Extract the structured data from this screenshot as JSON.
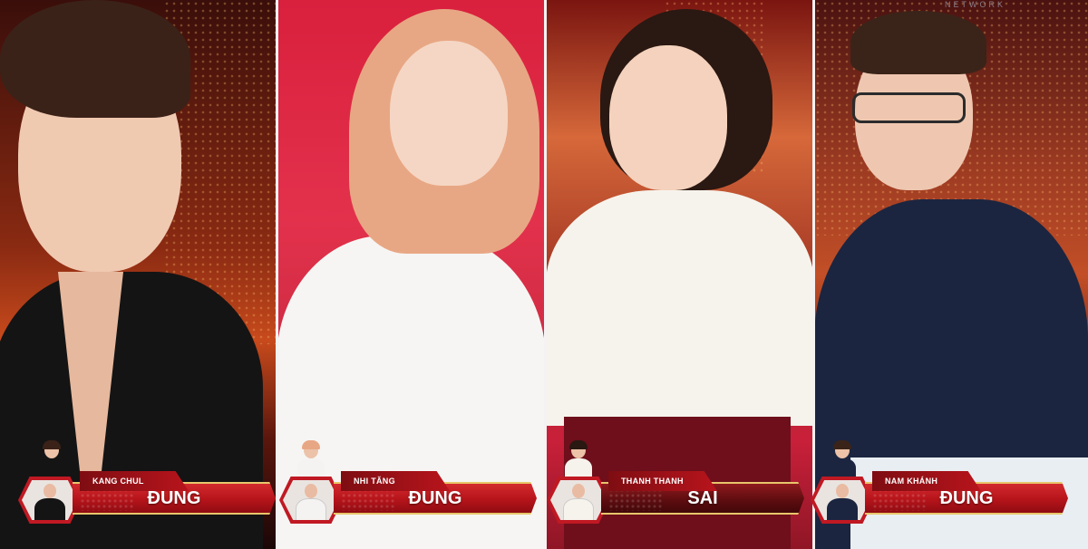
{
  "watermark": "NETWORK",
  "contestants": [
    {
      "name": "KANG CHUL",
      "result": "ĐÚNG",
      "correct": true,
      "shirt_color": "#111111"
    },
    {
      "name": "NHI TĂNG",
      "result": "ĐÚNG",
      "correct": true,
      "shirt_color": "#f4f3f1"
    },
    {
      "name": "THANH THANH",
      "result": "SAI",
      "correct": false,
      "shirt_color": "#f6f3ec"
    },
    {
      "name": "NAM KHÁNH",
      "result": "ĐÚNG",
      "correct": true,
      "shirt_color": "#1b2540"
    }
  ],
  "colors": {
    "banner_red": "#b8141c",
    "banner_dark_red": "#5f0d10",
    "gold_trim": "#e8c66a",
    "divider": "#f5f2f2"
  }
}
